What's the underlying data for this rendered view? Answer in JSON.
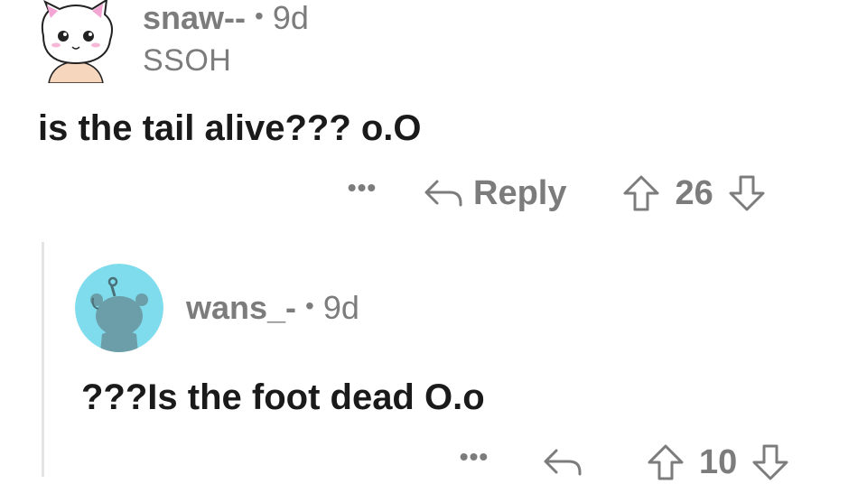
{
  "comments": [
    {
      "username": "snaw--",
      "separator": "•",
      "age": "9d",
      "flair": "SSOH",
      "body": "is the tail alive??? o.O",
      "more": "•••",
      "reply_label": "Reply",
      "score": "26"
    },
    {
      "username": "wans_-",
      "separator": "•",
      "age": "9d",
      "body": "???Is the foot dead O.o",
      "more": "•••",
      "score": "10"
    }
  ],
  "colors": {
    "text": "#1a1a1a",
    "meta": "#7c7c7c",
    "thread_line": "#e4e4e4",
    "avatar2_bg": "#7fdcec"
  },
  "icons": {
    "avatar1": "cat-avatar-icon",
    "avatar2": "snoo-avatar-icon",
    "reply": "reply-arrow-icon",
    "upvote": "upvote-arrow-icon",
    "downvote": "downvote-arrow-icon"
  }
}
